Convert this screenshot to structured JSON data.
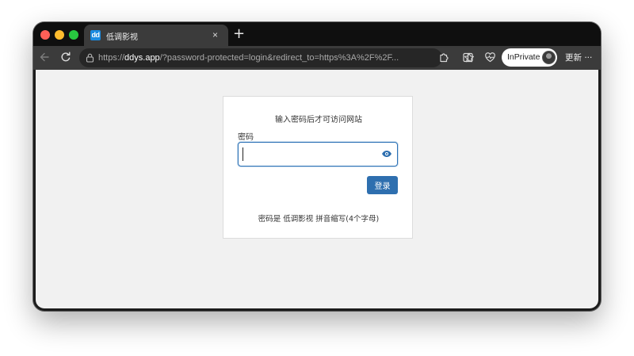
{
  "tab": {
    "favicon_text": "dd",
    "title": "低调影视",
    "close_glyph": "×"
  },
  "new_tab_glyph": "+",
  "address_bar": {
    "scheme": "https://",
    "host": "ddys.app",
    "rest": "/?password-protected=login&redirect_to=https%3A%2F%2F..."
  },
  "inprivate": {
    "label": "InPrivate"
  },
  "update": {
    "label": "更新",
    "more_glyph": "···"
  },
  "login_form": {
    "heading": "输入密码后才可访问网站",
    "password_label": "密码",
    "password_value": "",
    "submit_label": "登录",
    "hint": "密码是 低调影视 拼音缩写(4个字母)"
  },
  "icons": {
    "back": "back-arrow-icon",
    "reload": "reload-icon",
    "lock": "lock-icon",
    "favorite": "star-icon",
    "extensions": "puzzle-icon",
    "split": "split-screen-icon",
    "health": "heartbeat-icon",
    "show_password": "eye-icon"
  },
  "colors": {
    "accent": "#2e6faf",
    "favicon": "#1a8be0",
    "traffic_red": "#fe5f57",
    "traffic_yellow": "#febc2e",
    "traffic_green": "#28c840"
  }
}
